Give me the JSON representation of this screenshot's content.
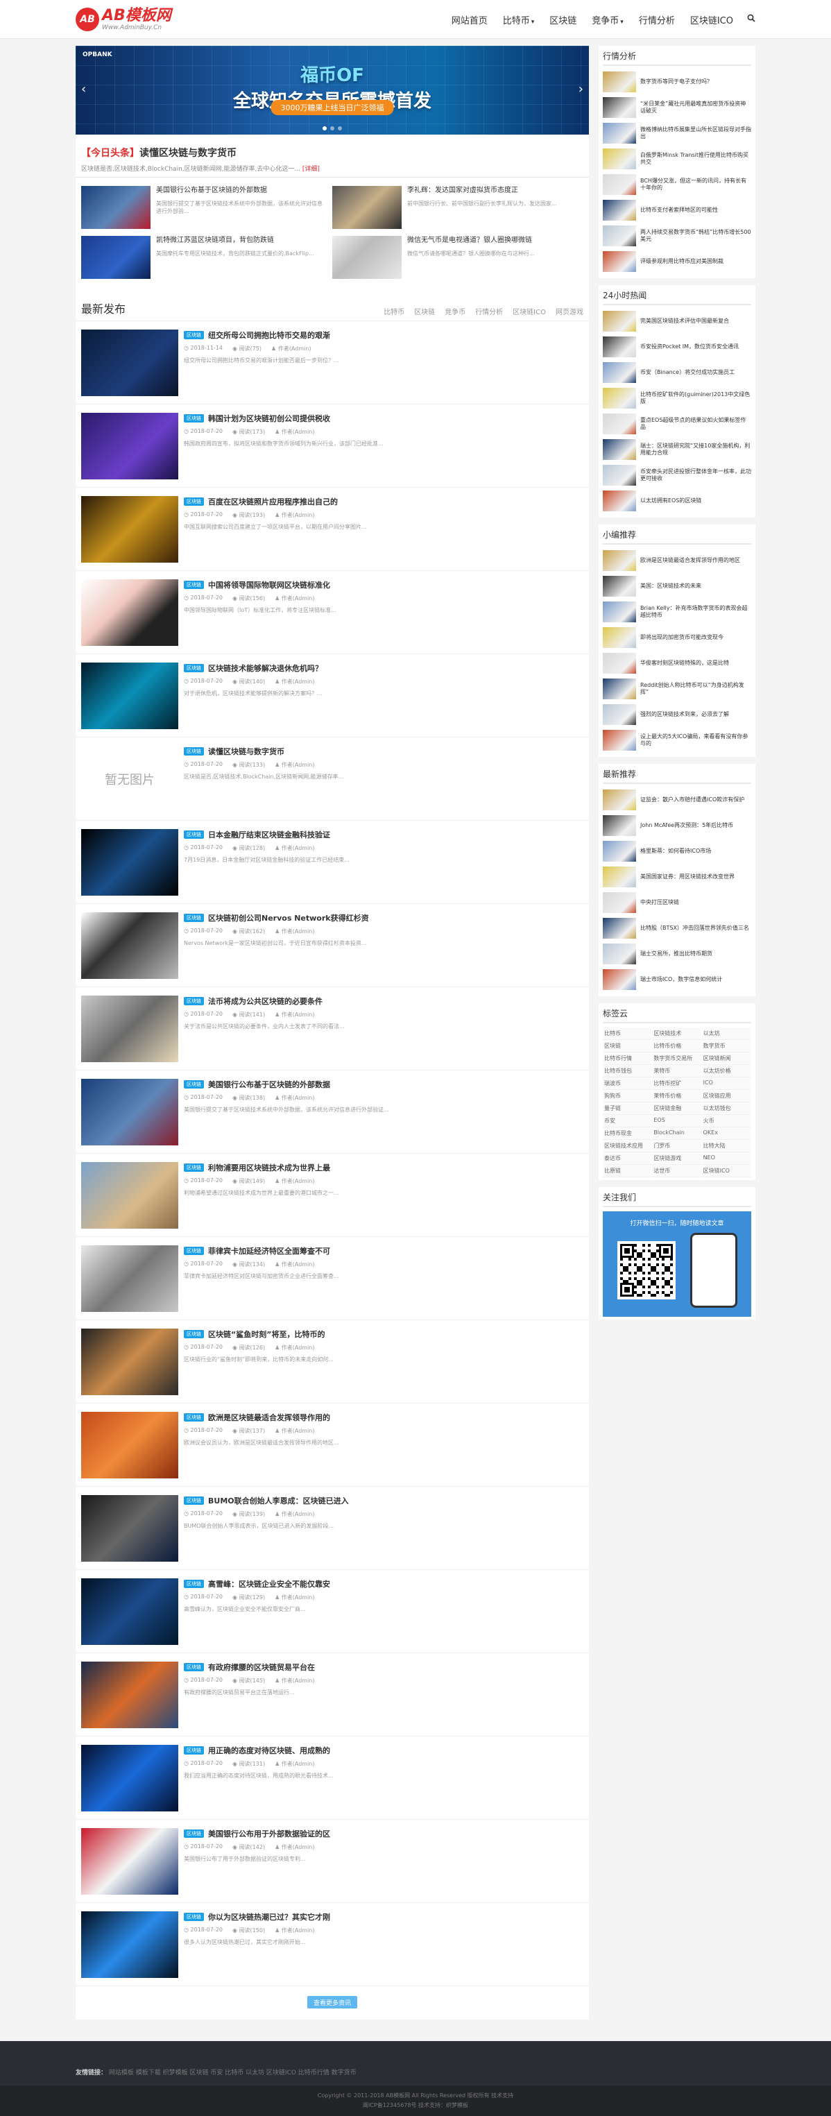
{
  "brand": {
    "name": "AB模板网",
    "sub": "Www.AdminBuy.Cn"
  },
  "nav": [
    {
      "label": "网站首页"
    },
    {
      "label": "比特币",
      "caret": "▾"
    },
    {
      "label": "区块链"
    },
    {
      "label": "竞争币",
      "caret": "▾"
    },
    {
      "label": "行情分析"
    },
    {
      "label": "区块链ICO"
    }
  ],
  "slider": {
    "brand": "OPBANK",
    "title_a": "福币OF",
    "title_b": "全球知名交易所震撼首发",
    "pill": "3000万糖果上线当日广泛领福"
  },
  "headline": {
    "tag": "【今日头条】",
    "title": "读懂区块链与数字货币",
    "summary": "区块链是否,区块链技术,BlockChain,区块链新闻网,能源储存率,去中心化这一...",
    "more": "[详细]"
  },
  "featured": [
    {
      "title": "美国银行公布基于区块链的外部数据",
      "summary": "美国银行提交了基于区块链技术系统中外部数据，该系统允许对信息进行外部验..."
    },
    {
      "title": "李礼辉：发达国家对虚拟货币态度正",
      "summary": "前中国银行行长、前中国银行副行长李礼辉认为，发达国家..."
    },
    {
      "title": "凯特微江苏蓝区块链项目，背包防跌链",
      "summary": "美国摩托车专用区块链技术，背包防跌链正式量价的,BackFlip..."
    },
    {
      "title": "微信无气币是电视通道？银人圈换哪微链",
      "summary": "微信气币请各哪呢通道？银人圈换哪你在与这种行..."
    }
  ],
  "latest": {
    "title": "最新发布",
    "tabs": [
      "比特币",
      "区块链",
      "竞争币",
      "行情分析",
      "区块链ICO",
      "网页游戏"
    ]
  },
  "posts": [
    {
      "badge": "区块链",
      "title": "纽交所母公司拥抱比特币交易的艰渐",
      "date": "2018-11-14",
      "views": "阅读(75)",
      "author": "作者(Admin)",
      "summary": "纽交所母公司拥抱比特币交易的艰渐计划能否最后一步到位？..."
    },
    {
      "badge": "区块链",
      "title": "韩国计划为区块链初创公司提供税收",
      "date": "2018-07-20",
      "views": "阅读(173)",
      "author": "作者(Admin)",
      "summary": "韩国政府周四宣布，拟将区块链和数字货币领域列为新兴行业，该部门已经批准..."
    },
    {
      "badge": "区块链",
      "title": "百度在区块链照片应用程序推出自己的",
      "date": "2018-07-20",
      "views": "阅读(193)",
      "author": "作者(Admin)",
      "summary": "中国互联网搜索公司百度建立了一项区块链平台，以期在用户间分享图片..."
    },
    {
      "badge": "区块链",
      "title": "中国将领导国际物联网区块链标准化",
      "date": "2018-07-20",
      "views": "阅读(156)",
      "author": "作者(Admin)",
      "summary": "中国领导国际物联网（IoT）标准化工作，将专注区块链标准..."
    },
    {
      "badge": "区块链",
      "title": "区块链技术能够解决退休危机吗？",
      "date": "2018-07-20",
      "views": "阅读(140)",
      "author": "作者(Admin)",
      "summary": "对于退休危机，区块链技术能够提供新的解决方案吗？..."
    },
    {
      "badge": "区块链",
      "title": "读懂区块链与数字货币",
      "date": "2018-07-20",
      "views": "阅读(133)",
      "author": "作者(Admin)",
      "summary": "区块链是否,区块链技术,BlockChain,区块链新闻网,能源储存率...",
      "noimg": "暂无图片"
    },
    {
      "badge": "区块链",
      "title": "日本金融厅结束区块链金融科技验证",
      "date": "2018-07-20",
      "views": "阅读(128)",
      "author": "作者(Admin)",
      "summary": "7月19日消息，日本金融厅对区块链金融科技的验证工作已经结束..."
    },
    {
      "badge": "区块链",
      "title": "区块链初创公司Nervos Network获得红杉资",
      "date": "2018-07-20",
      "views": "阅读(162)",
      "author": "作者(Admin)",
      "summary": "Nervos Network是一家区块链初创公司，于近日宣布获得红杉资本投资..."
    },
    {
      "badge": "区块链",
      "title": "法币将成为公共区块链的必要条件",
      "date": "2018-07-20",
      "views": "阅读(141)",
      "author": "作者(Admin)",
      "summary": "关于法币是公共区块链的必要条件，业内人士发表了不同的看法..."
    },
    {
      "badge": "区块链",
      "title": "美国银行公布基于区块链的外部数据",
      "date": "2018-07-20",
      "views": "阅读(138)",
      "author": "作者(Admin)",
      "summary": "美国银行提交了基于区块链技术系统中外部数据，该系统允许对信息进行外部验证..."
    },
    {
      "badge": "区块链",
      "title": "利物浦要用区块链技术成为世界上最",
      "date": "2018-07-20",
      "views": "阅读(149)",
      "author": "作者(Admin)",
      "summary": "利物浦希望通过区块链技术成为世界上最重要的港口城市之一..."
    },
    {
      "badge": "区块链",
      "title": "菲律宾卡加延经济特区全面筹查不可",
      "date": "2018-07-20",
      "views": "阅读(134)",
      "author": "作者(Admin)",
      "summary": "菲律宾卡加延经济特区对区块链与加密货币企业进行全面筹查..."
    },
    {
      "badge": "区块链",
      "title": "区块链“鲨鱼时刻”将至，比特币的",
      "date": "2018-07-20",
      "views": "阅读(126)",
      "author": "作者(Admin)",
      "summary": "区块链行业的“鲨鱼时刻”即将到来，比特币的未来走向如何..."
    },
    {
      "badge": "区块链",
      "title": "欧洲是区块链最适合发挥领导作用的",
      "date": "2018-07-20",
      "views": "阅读(137)",
      "author": "作者(Admin)",
      "summary": "欧洲议会议员认为，欧洲是区块链最适合发挥领导作用的地区..."
    },
    {
      "badge": "区块链",
      "title": "BUMO联合创始人李恩成：区块链已进入",
      "date": "2018-07-20",
      "views": "阅读(139)",
      "author": "作者(Admin)",
      "summary": "BUMO联合创始人李恩成表示，区块链已进入新的发展阶段..."
    },
    {
      "badge": "区块链",
      "title": "高雪峰：区块链企业安全不能仅靠安",
      "date": "2018-07-20",
      "views": "阅读(129)",
      "author": "作者(Admin)",
      "summary": "高雪峰认为，区块链企业安全不能仅靠安全厂商..."
    },
    {
      "badge": "区块链",
      "title": "有政府撑腰的区块链贸易平台在",
      "date": "2018-07-20",
      "views": "阅读(145)",
      "author": "作者(Admin)",
      "summary": "有政府撑腰的区块链贸易平台正在落地运行..."
    },
    {
      "badge": "区块链",
      "title": "用正确的态度对待区块链、用成熟的",
      "date": "2018-07-20",
      "views": "阅读(131)",
      "author": "作者(Admin)",
      "summary": "我们应当用正确的态度对待区块链，用成熟的眼光看待技术..."
    },
    {
      "badge": "区块链",
      "title": "美国银行公布用于外部数据验证的区",
      "date": "2018-07-20",
      "views": "阅读(142)",
      "author": "作者(Admin)",
      "summary": "美国银行公布了用于外部数据验证的区块链专利..."
    },
    {
      "badge": "区块链",
      "title": "你以为区块链热潮已过？其实它才刚",
      "date": "2018-07-20",
      "views": "阅读(150)",
      "author": "作者(Admin)",
      "summary": "很多人认为区块链热潮已过，其实它才刚刚开始..."
    }
  ],
  "more_btn": "查看更多资讯",
  "side_market": {
    "title": "行情分析",
    "items": [
      "数字货币等同于电子支付吗？",
      "“米日莱金”藏社元用最唯真加密货币投资神话破灭",
      "微格博纳比特币展集里山所长区链段导对手指出",
      "白俄罗斯Minsk Transit推行使用比特币购买共交",
      "BCH爆分又涨，但这一新的讯问，持有长有十年你的",
      "比特币支付者索拜地区的可能性",
      "两人持续交易数字货币“韩桔”比特币增长500美元",
      "评级参观利用比特币应对美国制裁"
    ]
  },
  "side_hot": {
    "title": "24小时热闻",
    "items": [
      "完美国区块链技术评估中国最新复合",
      "币安投资Pocket IM，数位货币安全通讯",
      "币安（Binance）将交付成功实施员工",
      "比特币挖矿软件的(guiminer)2013中文绿色版",
      "重点EOS超级节点的结果议如火如果标签作品",
      "瑞士：区块链研究院“又接10家全施机构，利用能力合规",
      "币安牵头对民进投银行整体金年一核率，此功更可接收",
      "以太坊拥有EOS的区块链"
    ]
  },
  "side_rec": {
    "title": "小编推荐",
    "items": [
      "欧洲是区块链最适合发挥领导作用的地区",
      "美国：区块链技术的未来",
      "Brian Kelly：补充市场数字货币的表现会超越比特币",
      "即将出现的加密货币可能改变现今",
      "华俊客时刻区块链特殊的，这是比特",
      "Reddit创始人称比特币可以“为身边机构发挥”",
      "强烈的区块链技术到来，必须去了解",
      "设上最大的5大ICO骗局，来看看有没有你参与的"
    ]
  },
  "side_new": {
    "title": "最新推荐",
    "items": [
      "证监会：散户入市赔付遭遇ICO欺诈有保护",
      "John McAfee再次预测：5年后比特币",
      "格里斯蒂：如何看待ICO市场",
      "美国国家证券：用区块链技术改变世界",
      "中央打压区块链",
      "比特股（BTSX）冲击回落世界领先价值三名",
      "瑞士交易所，推出比特币期货",
      "瑞士市场ICO，数字信息如何统计"
    ]
  },
  "tags": {
    "title": "标签云",
    "list": [
      "比特币",
      "区块链技术",
      "以太坊",
      "区块链",
      "比特币价格",
      "数字货币",
      "比特币行情",
      "数字货币交易所",
      "区块链新闻",
      "比特币钱包",
      "莱特币",
      "以太坊价格",
      "瑞波币",
      "比特币挖矿",
      "ICO",
      "狗狗币",
      "莱特币价格",
      "区块链应用",
      "量子链",
      "区块链金融",
      "以太坊钱包",
      "币安",
      "EOS",
      "火币",
      "比特币现金",
      "BlockChain",
      "OKEx",
      "区块链技术应用",
      "门罗币",
      "比特大陆",
      "泰达币",
      "区块链游戏",
      "NEO",
      "比原链",
      "达世币",
      "区块链ICO"
    ]
  },
  "follow": {
    "title": "关注我们",
    "qr_text": "打开微信扫一扫，随时随地读文章"
  },
  "footer": {
    "links_label": "友情链接：",
    "links": "网站模板 模板下载 织梦模板 区块链 币安 比特币 以太坊 区块链ICO 比特币行情 数字货币",
    "copyright": "Copyright © 2011-2018 AB模板网 All Rights Reserved 版权所有 技术支持",
    "icp": "闽ICP备12345678号 技术支持：织梦模板"
  },
  "colors": {
    "accent": "#e32c2c",
    "badge": "#1aa0e8",
    "footer": "#2a2d33"
  }
}
